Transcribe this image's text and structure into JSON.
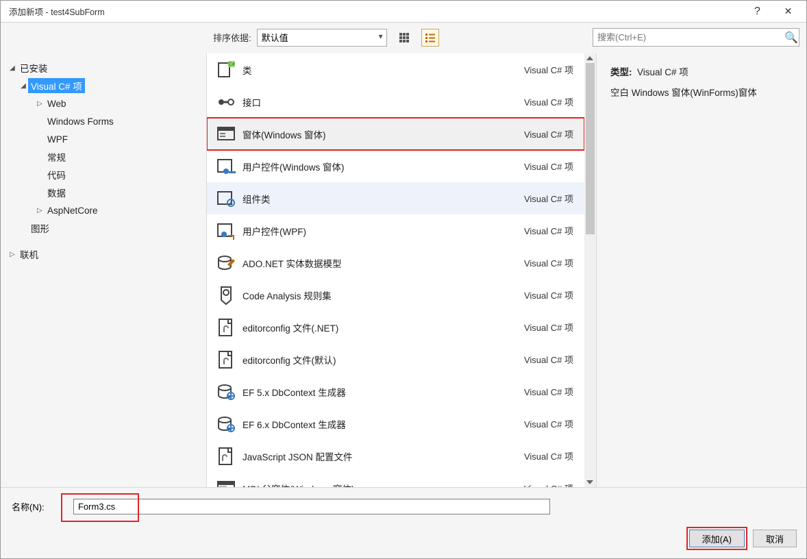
{
  "title": "添加新项 - test4SubForm",
  "titlebar": {
    "help": "?",
    "close": "✕"
  },
  "toolbar": {
    "sort_label": "排序依据:",
    "sort_value": "默认值",
    "search_placeholder": "搜索(Ctrl+E)"
  },
  "tree": {
    "installed_label": "已安装",
    "vcsharp_label": "Visual C# 项",
    "children": [
      "Web",
      "Windows Forms",
      "WPF",
      "常规",
      "代码",
      "数据",
      "AspNetCore"
    ],
    "graphics_label": "图形",
    "online_label": "联机"
  },
  "list_tag": "Visual C# 项",
  "items": [
    {
      "label": "类"
    },
    {
      "label": "接口"
    },
    {
      "label": "窗体(Windows 窗体)"
    },
    {
      "label": "用户控件(Windows 窗体)"
    },
    {
      "label": "组件类"
    },
    {
      "label": "用户控件(WPF)"
    },
    {
      "label": "ADO.NET 实体数据模型"
    },
    {
      "label": "Code Analysis 规则集"
    },
    {
      "label": "editorconfig 文件(.NET)"
    },
    {
      "label": "editorconfig 文件(默认)"
    },
    {
      "label": "EF 5.x DbContext 生成器"
    },
    {
      "label": "EF 6.x DbContext 生成器"
    },
    {
      "label": "JavaScript JSON 配置文件"
    },
    {
      "label": "MDI 父窗体(Windows 窗体)"
    }
  ],
  "info": {
    "type_label": "类型:",
    "type_value": "Visual C# 项",
    "desc": "空白 Windows 窗体(WinForms)窗体"
  },
  "bottom": {
    "name_label": "名称(N):",
    "name_value": "Form3.cs",
    "add_label": "添加(A)",
    "cancel_label": "取消"
  }
}
